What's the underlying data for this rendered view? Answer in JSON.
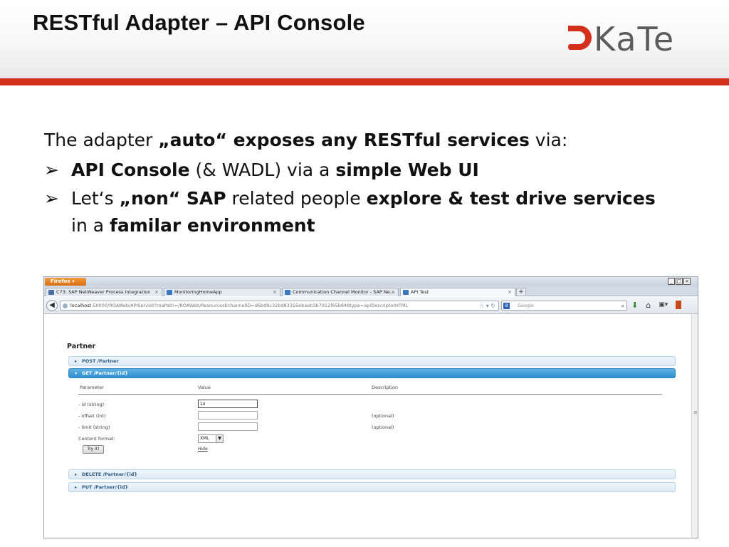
{
  "slide": {
    "title": "RESTful Adapter – API Console",
    "logo_text": "KaTe",
    "accent_color": "#d42f1a"
  },
  "body": {
    "intro": [
      "The adapter ",
      "„auto“ exposes any RESTful services",
      " via:"
    ],
    "bullets": [
      [
        "API Console",
        " (& WADL) via a ",
        "simple Web UI"
      ],
      [
        "Let‘s ",
        "„non“ SAP",
        " related people ",
        "explore & test drive services",
        " in a ",
        "familar environment"
      ]
    ]
  },
  "browser": {
    "app_button": "Firefox",
    "window_controls": [
      "_",
      "□",
      "×"
    ],
    "tabs": [
      {
        "label": "C73: SAP NetWeaver Process Integration",
        "active": false
      },
      {
        "label": "MonitoringHomeApp",
        "active": false
      },
      {
        "label": "Communication Channel Monitor - SAP Ne...",
        "active": false
      },
      {
        "label": "API Test",
        "active": true
      }
    ],
    "new_tab": "+",
    "url_host": "localhost",
    "url_rest": ":50000/ROAWeb/APIServlet?roaPath=/ROAWeb/ResourcesbchannelID=d6bd9c32bd83316ebaeb3b7012f65b848type=apiDescriptorHTML",
    "search_placeholder": "Google",
    "search_engine_icon": "google-icon",
    "icons": [
      "back-icon",
      "globe-icon",
      "star-icon",
      "refresh-icon",
      "search-icon",
      "download-icon",
      "home-icon",
      "bookmarks-icon",
      "extension-icon"
    ]
  },
  "api": {
    "resource": "Partner",
    "operations": [
      {
        "label": "POST /Partner",
        "expanded": false
      },
      {
        "label": "GET /Partner/{id}",
        "expanded": true
      },
      {
        "label": "DELETE /Partner/{id}",
        "expanded": false
      },
      {
        "label": "PUT /Partner/{id}",
        "expanded": false
      }
    ],
    "columns": {
      "parameter": "Parameter",
      "value": "Value",
      "description": "Description"
    },
    "params": [
      {
        "name": "- id (string)",
        "value": "14",
        "description": ""
      },
      {
        "name": "- offset (int)",
        "value": "",
        "description": "(optional)"
      },
      {
        "name": "- limit (string)",
        "value": "",
        "description": "(optional)"
      }
    ],
    "content_format_label": "Content format:",
    "content_format_value": "XML",
    "try_button": "Try it!",
    "hide_link": "Hide"
  }
}
